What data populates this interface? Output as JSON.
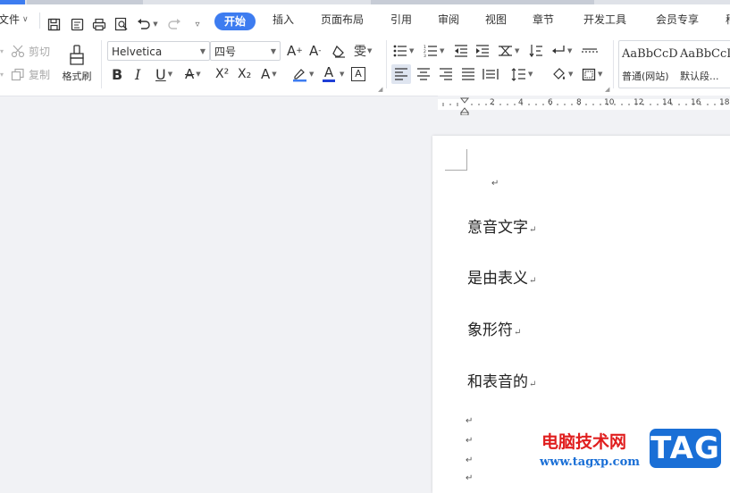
{
  "menu": {
    "file": "文件",
    "tabs": [
      "开始",
      "插入",
      "页面布局",
      "引用",
      "审阅",
      "视图",
      "章节",
      "开发工具",
      "会员专享"
    ],
    "more_tab_fragment": "稻"
  },
  "ribbon": {
    "cut": "剪切",
    "copy": "复制",
    "format_painter": "格式刷",
    "font_name": "Helvetica",
    "font_size": "四号",
    "grow_font": "A",
    "shrink_font": "A",
    "bold": "B",
    "italic": "I",
    "underline": "U",
    "strikethrough": "A",
    "superscript": "X²",
    "subscript": "X₂",
    "text_effect": "A",
    "font_color": "A",
    "char_border": "A",
    "styles": [
      {
        "preview": "AaBbCcD",
        "name": "普通(网站)"
      },
      {
        "preview": "AaBbCcD",
        "name": "默认段..."
      }
    ]
  },
  "ruler": {
    "ticks": [
      "2",
      "4",
      "6",
      "8",
      "10",
      "12",
      "14",
      "16",
      "18"
    ]
  },
  "document": {
    "paragraphs": [
      "意音文字",
      "是由表义",
      "象形符",
      "和表音的"
    ],
    "paragraph_mark": "↵"
  },
  "watermark": {
    "cn": "电脑技术网",
    "url": "www.tagxp.com",
    "badge": "TAG"
  },
  "colors": {
    "accent": "#3d7cf0",
    "badge_bg": "#1a6fd6",
    "watermark_red": "#e01e1e"
  }
}
